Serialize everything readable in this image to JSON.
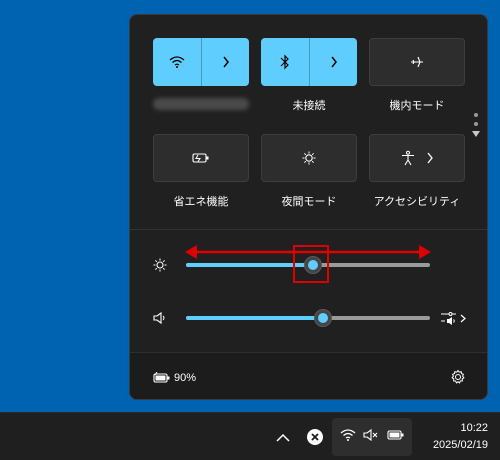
{
  "quick_settings": {
    "tiles_row1": [
      {
        "label": "",
        "icon": "wifi-icon",
        "active": true
      },
      {
        "label": "未接続",
        "icon": "bluetooth-icon",
        "active": true
      },
      {
        "label": "機内モード",
        "icon": "airplane-icon",
        "active": false
      }
    ],
    "tiles_row2": [
      {
        "label": "省エネ機能",
        "icon": "battery-saver-icon",
        "active": false
      },
      {
        "label": "夜間モード",
        "icon": "night-light-icon",
        "active": false
      },
      {
        "label": "アクセシビリティ",
        "icon": "accessibility-icon",
        "active": false
      }
    ],
    "brightness": {
      "icon": "brightness-icon",
      "level_percent": 52
    },
    "volume": {
      "icon": "speaker-icon",
      "level_percent": 56
    },
    "battery_text": "90%",
    "settings_icon": "gear-icon"
  },
  "taskbar": {
    "time": "10:22",
    "date": "2025/02/19",
    "tray_icons": [
      "chevron-up-icon",
      "close-circle-icon",
      "wifi-icon",
      "volume-muted-icon",
      "battery-icon"
    ]
  },
  "colors": {
    "accent": "#60cdff",
    "desktop": "#0063b1",
    "panel": "#202020",
    "annotation": "#e00000"
  }
}
